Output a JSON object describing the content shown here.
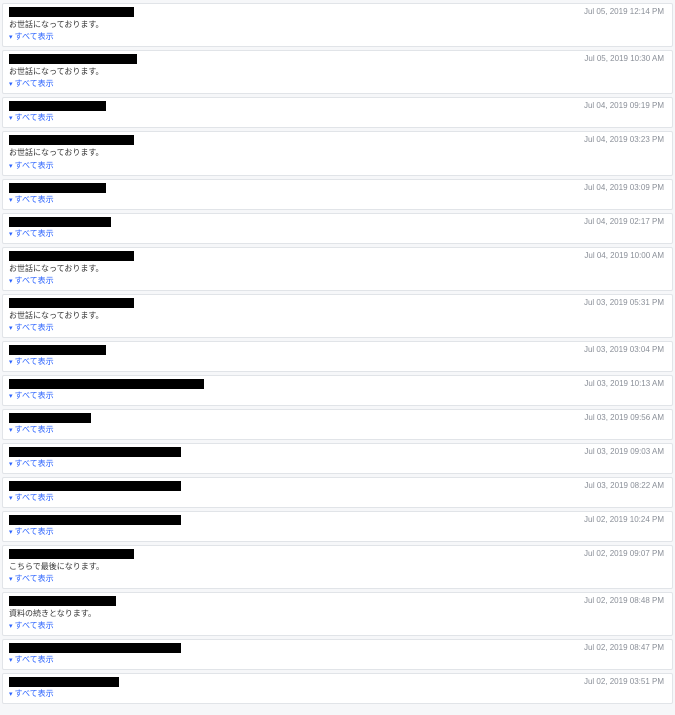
{
  "expand_label": "すべて表示",
  "items": [
    {
      "timestamp": "Jul 05, 2019 12:14 PM",
      "subject_width": 125,
      "body": "お世話になっております。"
    },
    {
      "timestamp": "Jul 05, 2019 10:30 AM",
      "subject_width": 128,
      "body": "お世話になっております。"
    },
    {
      "timestamp": "Jul 04, 2019 09:19 PM",
      "subject_width": 97,
      "body": ""
    },
    {
      "timestamp": "Jul 04, 2019 03:23 PM",
      "subject_width": 125,
      "body": "お世話になっております。"
    },
    {
      "timestamp": "Jul 04, 2019 03:09 PM",
      "subject_width": 97,
      "body": ""
    },
    {
      "timestamp": "Jul 04, 2019 02:17 PM",
      "subject_width": 102,
      "body": ""
    },
    {
      "timestamp": "Jul 04, 2019 10:00 AM",
      "subject_width": 125,
      "body": "お世話になっております。"
    },
    {
      "timestamp": "Jul 03, 2019 05:31 PM",
      "subject_width": 125,
      "body": "お世話になっております。"
    },
    {
      "timestamp": "Jul 03, 2019 03:04 PM",
      "subject_width": 97,
      "body": ""
    },
    {
      "timestamp": "Jul 03, 2019 10:13 AM",
      "subject_width": 195,
      "body": ""
    },
    {
      "timestamp": "Jul 03, 2019 09:56 AM",
      "subject_width": 82,
      "body": ""
    },
    {
      "timestamp": "Jul 03, 2019 09:03 AM",
      "subject_width": 172,
      "body": ""
    },
    {
      "timestamp": "Jul 03, 2019 08:22 AM",
      "subject_width": 172,
      "body": ""
    },
    {
      "timestamp": "Jul 02, 2019 10:24 PM",
      "subject_width": 172,
      "body": ""
    },
    {
      "timestamp": "Jul 02, 2019 09:07 PM",
      "subject_width": 125,
      "body": "こちらで最後になります。"
    },
    {
      "timestamp": "Jul 02, 2019 08:48 PM",
      "subject_width": 107,
      "body": "資料の続きとなります。"
    },
    {
      "timestamp": "Jul 02, 2019 08:47 PM",
      "subject_width": 172,
      "body": ""
    },
    {
      "timestamp": "Jul 02, 2019 03:51 PM",
      "subject_width": 110,
      "body": ""
    }
  ]
}
